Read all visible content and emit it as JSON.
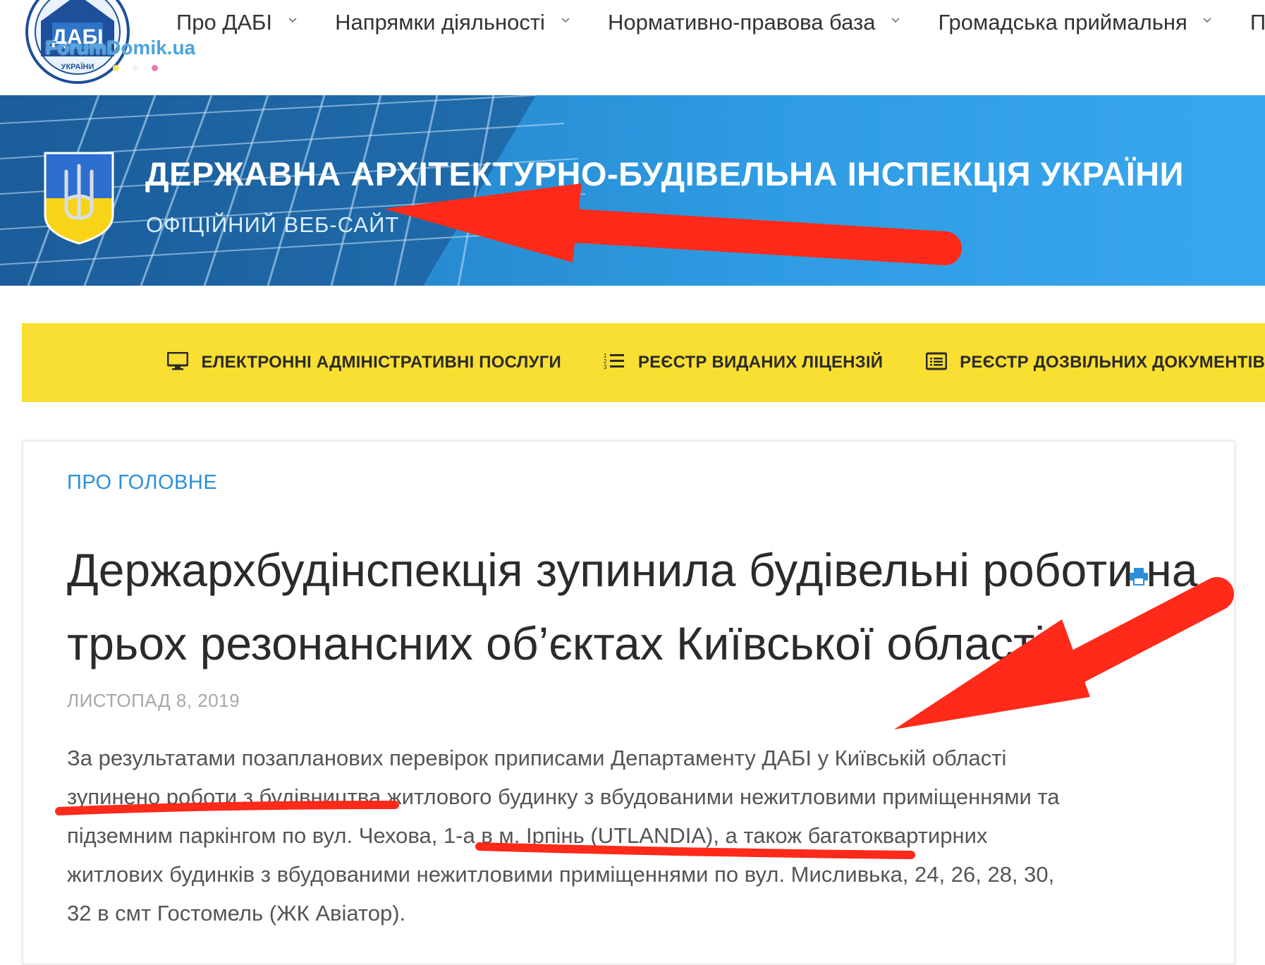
{
  "logo": {
    "watermark": "ForumDomik.ua"
  },
  "nav": {
    "items": [
      {
        "label": "Про ДАБІ"
      },
      {
        "label": "Напрямки діяльності"
      },
      {
        "label": "Нормативно-правова база"
      },
      {
        "label": "Громадська приймальня"
      },
      {
        "label": "Пр"
      }
    ]
  },
  "banner": {
    "title": "ДЕРЖАВНА АРХІТЕКТУРНО-БУДІВЕЛЬНА ІНСПЕКЦІЯ УКРАЇНИ",
    "subtitle": "ОФІЦІЙНИЙ ВЕБ-САЙТ"
  },
  "quick_links": [
    {
      "label": "ЕЛЕКТРОННІ АДМІНІСТРАТИВНІ ПОСЛУГИ",
      "icon": "monitor-icon"
    },
    {
      "label": "РЕЄСТР ВИДАНИХ ЛІЦЕНЗІЙ",
      "icon": "numbered-list-icon"
    },
    {
      "label": "РЕЄСТР ДОЗВІЛЬНИХ ДОКУМЕНТІВ",
      "icon": "document-list-icon"
    }
  ],
  "article": {
    "category": "ПРО ГОЛОВНЕ",
    "title": "Держархбудінспекція зупинила будівельні роботи на трьох резонансних об’єктах Київської області",
    "date": "ЛИСТОПАД 8, 2019",
    "body": "За результатами позапланових перевірок приписами Департаменту ДАБІ у Київській області зупинено роботи з будівництва житлового будинку з вбудованими нежитловими приміщеннями та підземним паркінгом по вул. Чехова, 1-а в м. Ірпінь (UTLANDIA), а також багатоквартирних житлових будинків з вбудованими нежитловими приміщеннями по вул. Мисливька, 24, 26, 28, 30, 32 в смт Гостомель (ЖК Авіатор)."
  },
  "colors": {
    "accent_blue": "#2a8fd8",
    "banner_blue": "#2e9be2",
    "quickbar_yellow": "#f9df32",
    "annotation_red": "#ff2a1a"
  }
}
